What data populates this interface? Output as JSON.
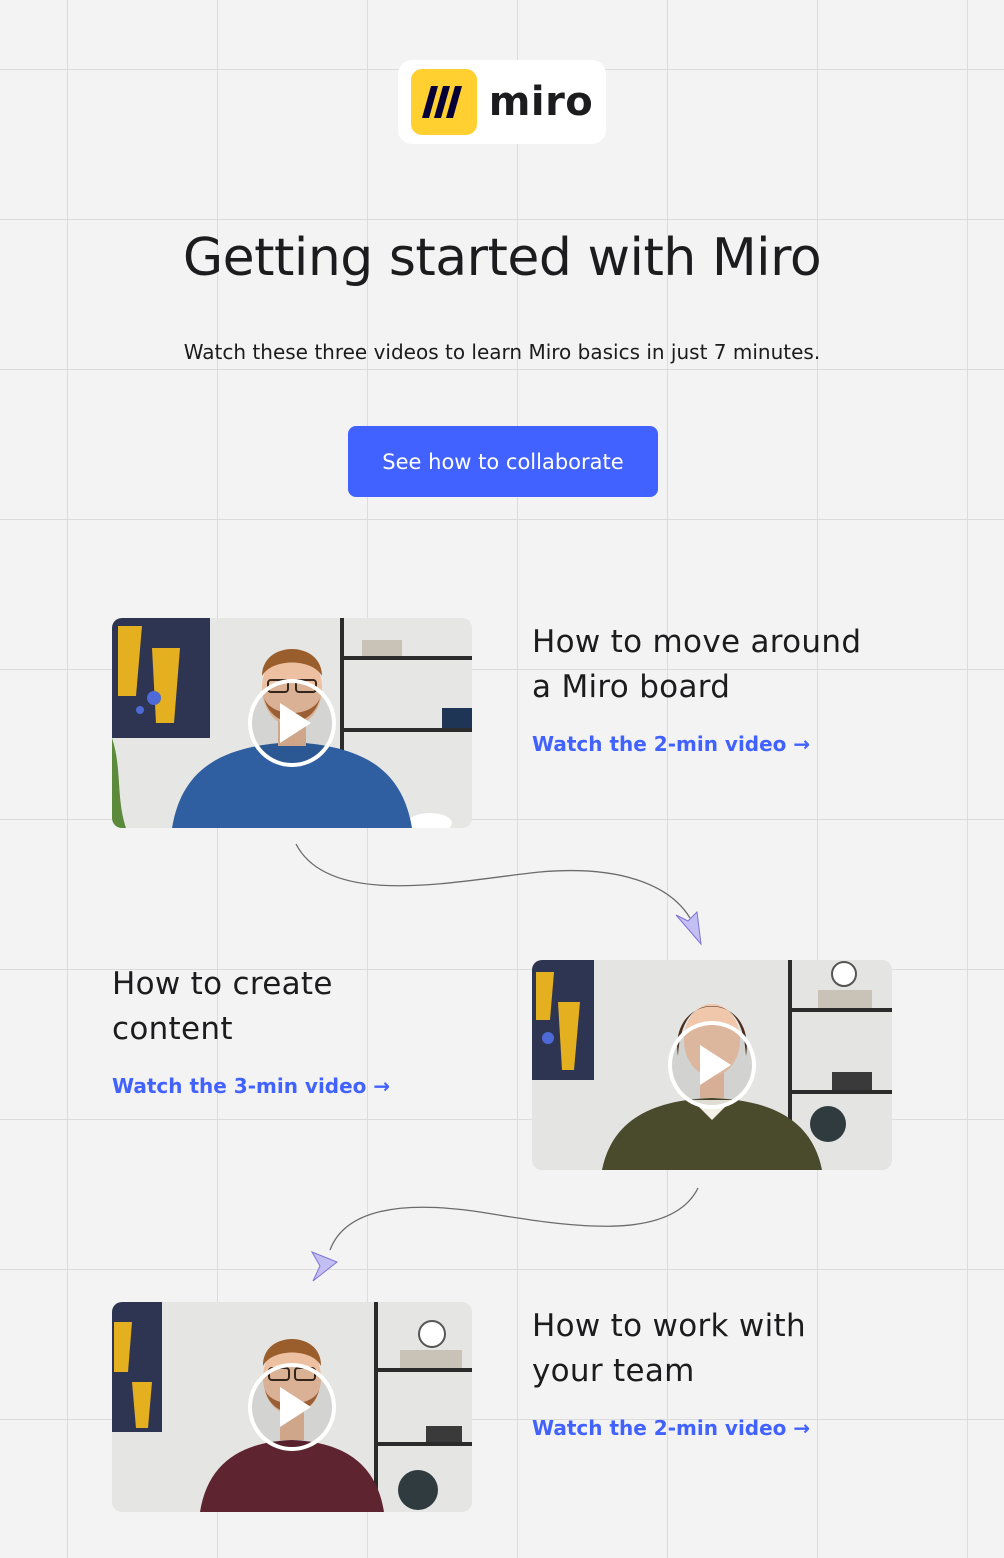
{
  "logo": {
    "wordmark": "miro",
    "mark_color": "#ffd02f"
  },
  "hero": {
    "title": "Getting started with Miro",
    "subtitle": "Watch these three videos to learn Miro basics in just 7 minutes.",
    "cta_label": "See how to collaborate"
  },
  "accent_color": "#4262ff",
  "videos": [
    {
      "title_line1": "How to move around",
      "title_line2": "a Miro board",
      "link": "Watch the 2-min video →",
      "presenter_shirt": "#2f5fa0",
      "icon": "play-icon"
    },
    {
      "title_line1": "How to create",
      "title_line2": "content",
      "link": "Watch the 3-min video →",
      "presenter_shirt": "#4a4a2c",
      "icon": "play-icon"
    },
    {
      "title_line1": "How to work with",
      "title_line2": "your team",
      "link": "Watch the 2-min video →",
      "presenter_shirt": "#5e2430",
      "icon": "play-icon"
    }
  ]
}
